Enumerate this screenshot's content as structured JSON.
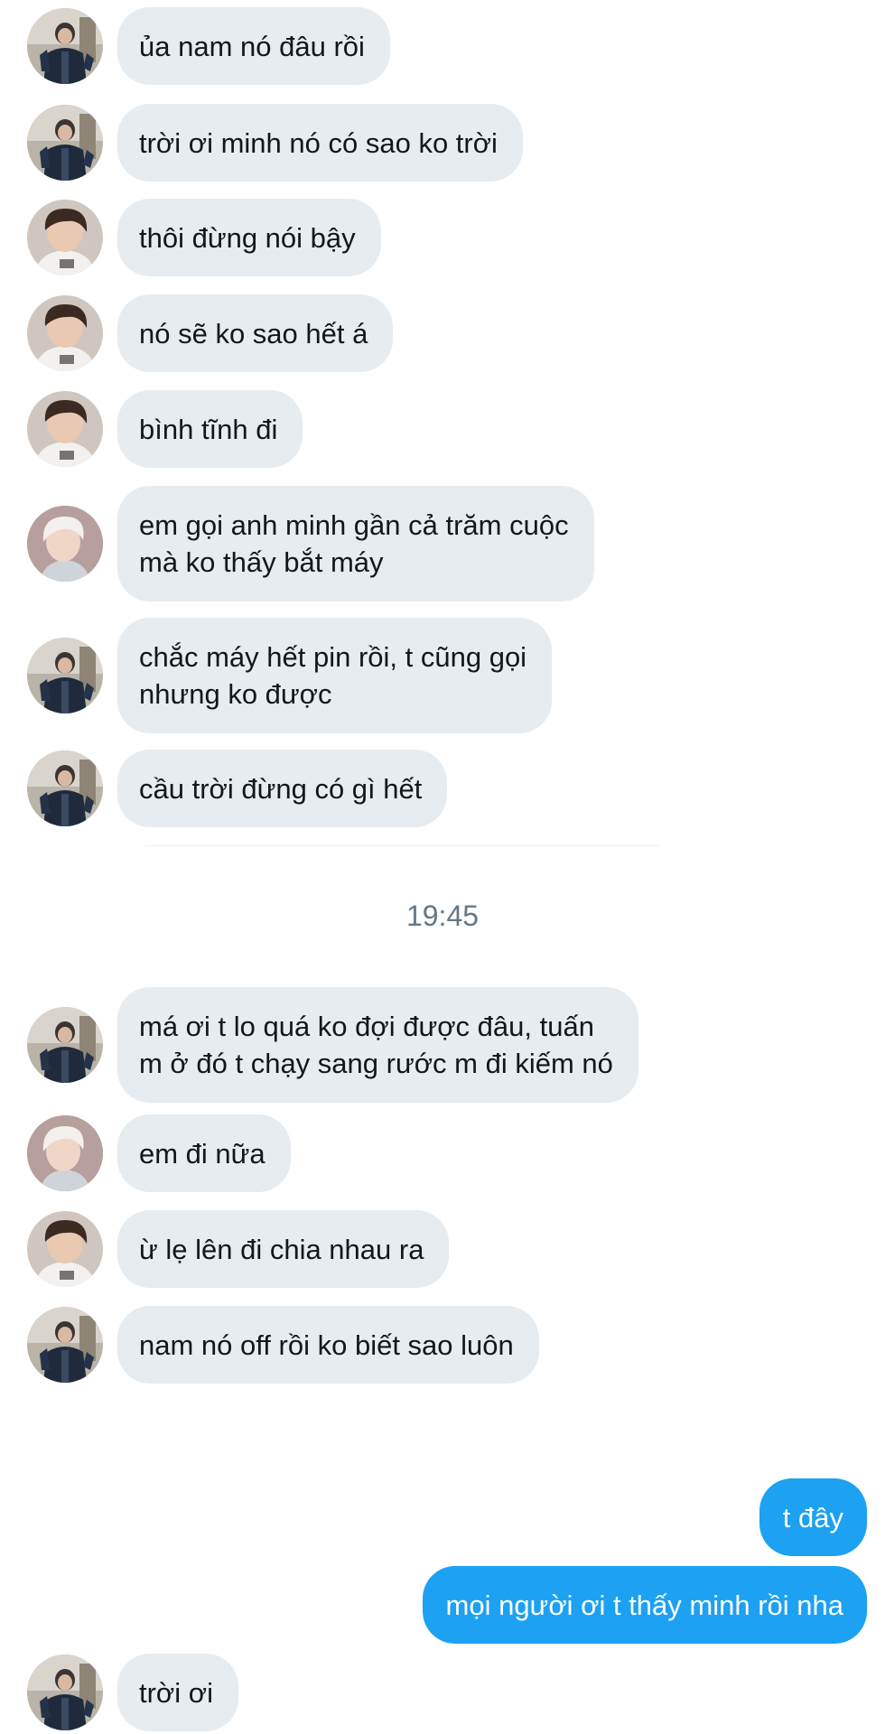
{
  "messages": [
    {
      "avatar": "avatar-a",
      "lines": [
        "ủa nam nó đâu rồi"
      ]
    },
    {
      "avatar": "avatar-a",
      "lines": [
        "trời ơi minh nó có sao ko trời"
      ]
    },
    {
      "avatar": "avatar-b",
      "lines": [
        "thôi đừng nói bậy"
      ]
    },
    {
      "avatar": "avatar-b",
      "lines": [
        "nó sẽ ko sao hết á"
      ]
    },
    {
      "avatar": "avatar-b",
      "lines": [
        "bình tĩnh đi"
      ]
    },
    {
      "avatar": "avatar-c",
      "lines": [
        "em gọi anh minh gần cả trăm cuộc",
        "mà ko thấy bắt máy"
      ]
    },
    {
      "avatar": "avatar-a",
      "lines": [
        "chắc máy hết pin rồi, t cũng gọi",
        "nhưng ko được"
      ]
    },
    {
      "avatar": "avatar-a",
      "lines": [
        "cầu trời đừng có gì hết"
      ]
    },
    {
      "avatar": "avatar-a",
      "lines": [
        "má ơi t lo quá ko đợi được đâu, tuấn",
        "m ở đó t chạy sang rước m đi kiếm nó"
      ]
    },
    {
      "avatar": "avatar-c",
      "lines": [
        "em đi nữa"
      ]
    },
    {
      "avatar": "avatar-b",
      "lines": [
        "ừ lẹ lên đi chia nhau ra"
      ]
    },
    {
      "avatar": "avatar-a",
      "lines": [
        "nam nó off rồi ko biết sao luôn"
      ]
    },
    {
      "avatar": "avatar-a",
      "lines": [
        "trời ơi"
      ]
    }
  ],
  "timestamp": "19:45",
  "sent": [
    {
      "text": "t đây"
    },
    {
      "text": "mọi người ơi t thấy minh rồi nha"
    }
  ],
  "colors": {
    "received_bubble": "#e6ecf0",
    "sent_bubble": "#1da1f2",
    "timestamp": "#657786"
  }
}
